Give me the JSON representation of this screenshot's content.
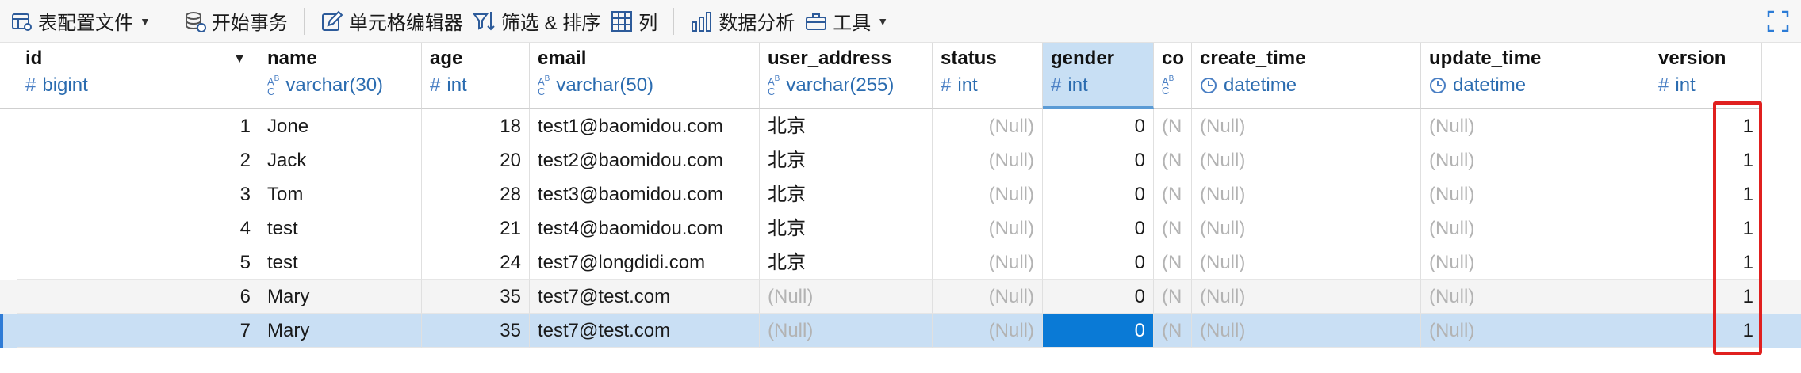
{
  "toolbar": {
    "config_file": "表配置文件",
    "begin_tx": "开始事务",
    "cell_editor": "单元格编辑器",
    "filter_sort": "筛选 & 排序",
    "columns": "列",
    "data_analysis": "数据分析",
    "tools": "工具"
  },
  "columns": [
    {
      "name": "id",
      "type": "bigint",
      "kind": "num"
    },
    {
      "name": "name",
      "type": "varchar(30)",
      "kind": "abc"
    },
    {
      "name": "age",
      "type": "int",
      "kind": "num"
    },
    {
      "name": "email",
      "type": "varchar(50)",
      "kind": "abc"
    },
    {
      "name": "user_address",
      "type": "varchar(255)",
      "kind": "abc"
    },
    {
      "name": "status",
      "type": "int",
      "kind": "num"
    },
    {
      "name": "gender",
      "type": "int",
      "kind": "num"
    },
    {
      "name": "co",
      "type": "",
      "kind": "abc"
    },
    {
      "name": "create_time",
      "type": "datetime",
      "kind": "time"
    },
    {
      "name": "update_time",
      "type": "datetime",
      "kind": "time"
    },
    {
      "name": "version",
      "type": "int",
      "kind": "num"
    }
  ],
  "rows": [
    [
      "1",
      "Jone",
      "18",
      "test1@baomidou.com",
      "北京",
      "(Null)",
      "0",
      "(N",
      "(Null)",
      "(Null)",
      "1"
    ],
    [
      "2",
      "Jack",
      "20",
      "test2@baomidou.com",
      "北京",
      "(Null)",
      "0",
      "(N",
      "(Null)",
      "(Null)",
      "1"
    ],
    [
      "3",
      "Tom",
      "28",
      "test3@baomidou.com",
      "北京",
      "(Null)",
      "0",
      "(N",
      "(Null)",
      "(Null)",
      "1"
    ],
    [
      "4",
      "test",
      "21",
      "test4@baomidou.com",
      "北京",
      "(Null)",
      "0",
      "(N",
      "(Null)",
      "(Null)",
      "1"
    ],
    [
      "5",
      "test",
      "24",
      "test7@longdidi.com",
      "北京",
      "(Null)",
      "0",
      "(N",
      "(Null)",
      "(Null)",
      "1"
    ],
    [
      "6",
      "Mary",
      "35",
      "test7@test.com",
      "(Null)",
      "(Null)",
      "0",
      "(N",
      "(Null)",
      "(Null)",
      "1"
    ],
    [
      "7",
      "Mary",
      "35",
      "test7@test.com",
      "(Null)",
      "(Null)",
      "0",
      "(N",
      "(Null)",
      "(Null)",
      "1"
    ]
  ],
  "colors": {
    "selection": "#c9dff4",
    "focus_cell": "#0a7ad6",
    "highlight": "#e0201f",
    "type_text": "#2b6cb0"
  }
}
